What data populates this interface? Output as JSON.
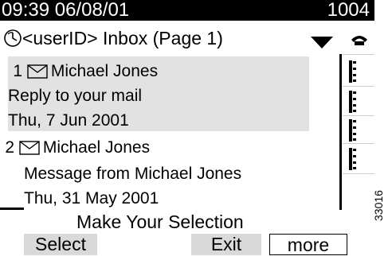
{
  "status_bar": {
    "datetime": "09:39 06/08/01",
    "extension": "1004"
  },
  "header": {
    "title": "<userID> Inbox (Page 1)",
    "clock_icon": "clock-icon",
    "dropdown_icon": "triangle-down-icon",
    "phone_icon": "phone-handset-icon"
  },
  "messages": [
    {
      "number": "1",
      "sender": "Michael Jones",
      "subject": "Reply to your mail",
      "date": "Thu, 7 Jun  2001",
      "icon": "envelope-icon",
      "selected": true
    },
    {
      "number": "2",
      "sender": "Michael Jones",
      "subject": "Message from Michael Jones",
      "date": "Thu, 31 May 2001",
      "icon": "envelope-icon",
      "selected": false
    }
  ],
  "footer": {
    "prompt": "Make Your Selection",
    "softkeys": [
      "Select",
      "Exit",
      "more"
    ]
  },
  "figure_code": "33016",
  "colors": {
    "selected_bg": "#e2e2e2",
    "softkey_bg": "#d9d9d9",
    "bar_bg": "#000000"
  }
}
